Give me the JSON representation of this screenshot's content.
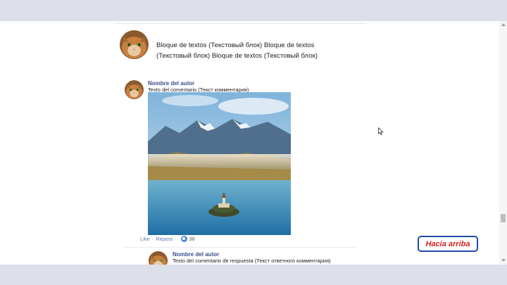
{
  "post": {
    "text": "Bloque de textos (Текстовый блок) Bloque de textos (Текстовый блок) Bloque de textos (Текстовый блок)"
  },
  "comment": {
    "author": "Nombre del autor",
    "text": "Texto del comentario (Текст комментария)",
    "actions": {
      "like": "Like",
      "separator": "·",
      "repost": "Repost",
      "like_count": "36"
    }
  },
  "reply": {
    "author": "Nombre del autor",
    "text": "Texto del comentario de respuesta (Текст ответного комментария)"
  },
  "back_to_top": {
    "label": "Hacia arriba"
  },
  "colors": {
    "chrome_bar": "#dde0ea",
    "author_link": "#3a4d8a",
    "action_link": "#5b7bb7",
    "button_border": "#1f4aa8",
    "button_text": "#d41f1f"
  },
  "icons": {
    "avatar": "cat-avatar-icon",
    "like": "like-icon",
    "cursor": "mouse-cursor-icon"
  }
}
